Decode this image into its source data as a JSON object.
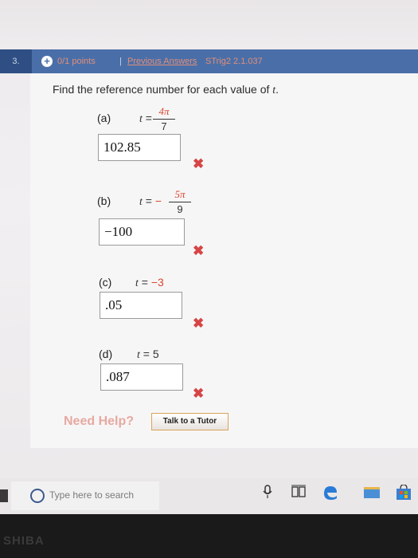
{
  "question_bar": {
    "number": "3.",
    "points": "0/1 points",
    "separator": "|",
    "previous_answers": "Previous Answers",
    "source": "STrig2 2.1.037"
  },
  "instruction": {
    "text": "Find the reference number for each value of ",
    "var": "t",
    "end": "."
  },
  "parts": [
    {
      "label": "(a)",
      "lhs": "t",
      "eq": "=",
      "sign": "",
      "numerator": "4π",
      "denominator": "7",
      "answer": "102.85"
    },
    {
      "label": "(b)",
      "lhs": "t",
      "eq": "=",
      "sign": "−",
      "numerator": "5π",
      "denominator": "9",
      "answer": "−100"
    },
    {
      "label": "(c)",
      "lhs": "t",
      "eq": "=",
      "value": "−3",
      "answer": ".05"
    },
    {
      "label": "(d)",
      "lhs": "t",
      "eq": "=",
      "value": "5",
      "answer": ".087"
    }
  ],
  "wrong_mark": "✖",
  "help": {
    "need_help": "Need Help?",
    "tutor_button": "Talk to a Tutor"
  },
  "taskbar": {
    "search_placeholder": "Type here to search",
    "icons": [
      "windows-start-icon",
      "cortana-ring-icon",
      "microphone-icon",
      "task-view-icon",
      "edge-icon",
      "file-explorer-icon",
      "store-icon"
    ]
  },
  "bezel": {
    "brand": "SHIBA"
  },
  "colors": {
    "question_bar": "#4a6fa8",
    "incorrect": "#d64545",
    "accent_red": "#d9462e",
    "edge_blue": "#2a7bd6"
  }
}
